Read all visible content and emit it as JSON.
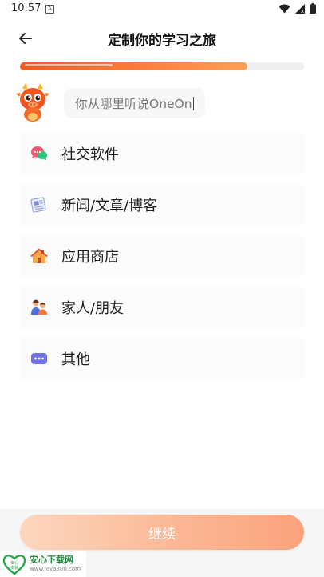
{
  "status_bar": {
    "time": "10:57",
    "notification": "A"
  },
  "header": {
    "title": "定制你的学习之旅"
  },
  "progress": {
    "fraction": 0.8
  },
  "question": {
    "text": "你从哪里听说OneOn"
  },
  "options": [
    {
      "label": "社交软件",
      "icon": "chat-bubbles-icon"
    },
    {
      "label": "新闻/文章/博客",
      "icon": "newspaper-icon"
    },
    {
      "label": "应用商店",
      "icon": "house-icon"
    },
    {
      "label": "家人/朋友",
      "icon": "family-icon"
    },
    {
      "label": "其他",
      "icon": "more-dots-icon"
    }
  ],
  "footer": {
    "continue_label": "继续"
  },
  "watermark": {
    "logo_text": "安心 安装",
    "title": "安心下载网",
    "url": "www.java800.com"
  },
  "colors": {
    "accent": "#f26a2a",
    "button": "#fbb592"
  }
}
